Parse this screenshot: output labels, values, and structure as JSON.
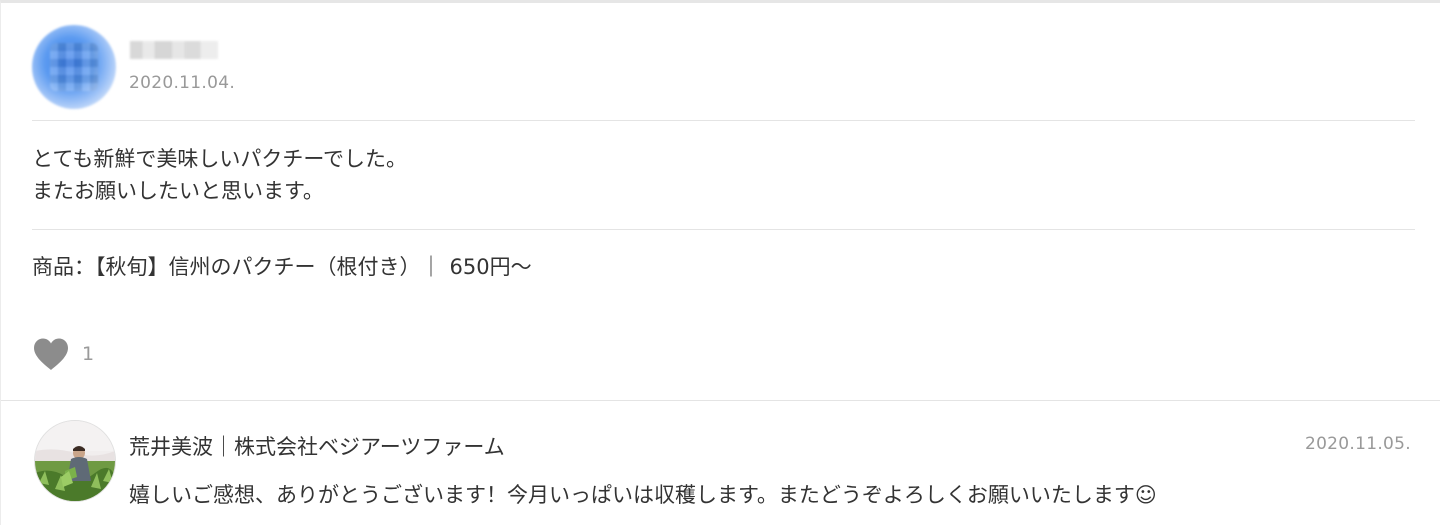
{
  "review": {
    "reviewer_name": "",
    "date": "2020.11.04.",
    "body_lines": [
      "とても新鮮で美味しいパクチーでした。",
      "またお願いしたいと思います。"
    ],
    "product_label": "商品：",
    "product_name": "【秋旬】信州のパクチー（根付き）",
    "product_separator": "｜",
    "product_price": "650円～",
    "like_count": "1"
  },
  "reply": {
    "name": "荒井美波｜株式会社ベジアーツファーム",
    "date": "2020.11.05.",
    "text": "嬉しいご感想、ありがとうございます！今月いっぱいは収穫します。またどうぞよろしくお願いいたします☺"
  },
  "icons": {
    "like": "heart-icon",
    "reviewer_avatar": "blurred-avatar",
    "reply_avatar": "farmer-photo-avatar"
  },
  "colors": {
    "text": "#333333",
    "muted": "#999999",
    "heart": "#8c8c8c",
    "divider": "#e4e4e4"
  }
}
